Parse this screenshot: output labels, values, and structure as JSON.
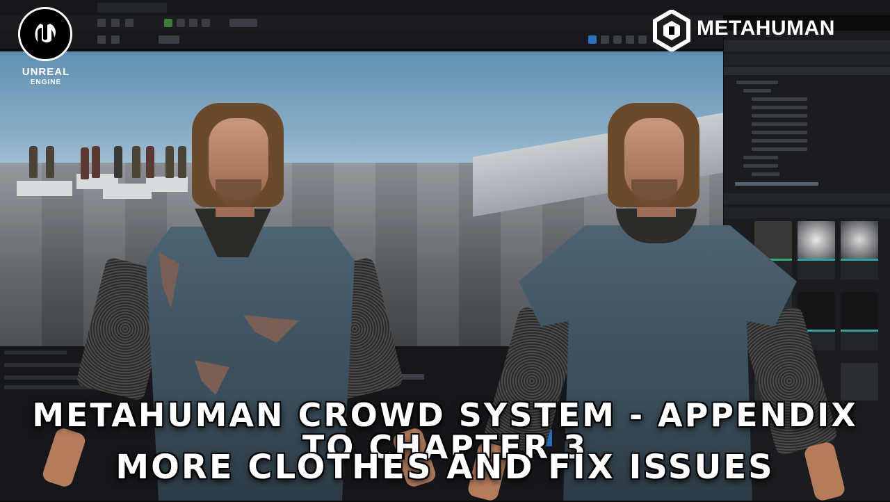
{
  "branding": {
    "engine_name": "UNREAL",
    "engine_sub": "ENGINE",
    "product_name": "METAHUMAN"
  },
  "headline": {
    "line1": "METAHUMAN CROWD SYSTEM - APPENDIX TO CHAPTER 3",
    "line2": "MORE CLOTHES AND FIX ISSUES"
  },
  "colors": {
    "sky_top": "#5f8fb0",
    "tunic": "#4d6473",
    "editor_bg": "#1a1c1f",
    "thumb_stripe_green": "#2fae6a",
    "thumb_stripe_teal": "#2aa7a0"
  },
  "icons": {
    "ue_logo": "unreal-engine-logo",
    "mh_logo": "metahuman-logo"
  }
}
